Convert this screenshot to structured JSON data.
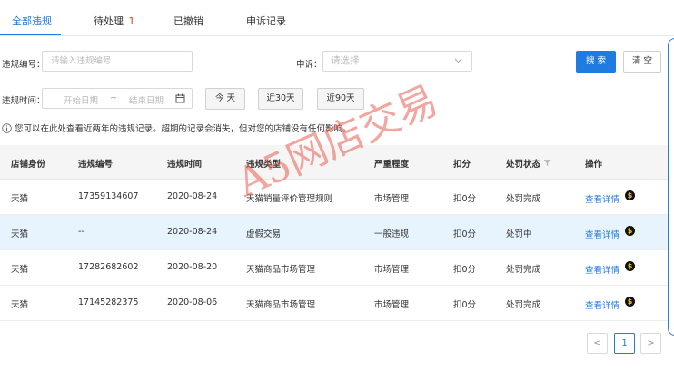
{
  "tabs": [
    {
      "label": "全部违规",
      "badge": ""
    },
    {
      "label": "待处理",
      "badge": "1"
    },
    {
      "label": "已撤销",
      "badge": ""
    },
    {
      "label": "申诉记录",
      "badge": ""
    }
  ],
  "filters": {
    "violation_id_label": "违规编号：",
    "violation_id_placeholder": "请输入违规编号",
    "appeal_label": "申诉：",
    "appeal_placeholder": "请选择",
    "time_label": "违规时间：",
    "start_date_placeholder": "开始日期",
    "date_separator": "~",
    "end_date_placeholder": "结束日期",
    "today_label": "今 天",
    "days30_label": "近30天",
    "days90_label": "近90天",
    "search_label": "搜 索",
    "clear_label": "清 空"
  },
  "notice": "您可以在此处查看近两年的违规记录。超期的记录会消失，但对您的店铺没有任何影响。",
  "table": {
    "columns": [
      "店铺身份",
      "违规编号",
      "违规时间",
      "违规类型",
      "严重程度",
      "扣分",
      "处罚状态",
      "操作"
    ],
    "rows": [
      {
        "identity": "天猫",
        "id": "17359134607",
        "time": "2020-08-24",
        "type": "天猫销量评价管理规则",
        "severity": "市场管理",
        "points": "扣0分",
        "status": "处罚完成",
        "action": "查看详情"
      },
      {
        "identity": "天猫",
        "id": "--",
        "time": "2020-08-24",
        "type": "虚假交易",
        "severity": "一般违规",
        "points": "扣0分",
        "status": "处罚中",
        "action": "查看详情"
      },
      {
        "identity": "天猫",
        "id": "17282682602",
        "time": "2020-08-20",
        "type": "天猫商品市场管理",
        "severity": "市场管理",
        "points": "扣0分",
        "status": "处罚完成",
        "action": "查看详情"
      },
      {
        "identity": "天猫",
        "id": "17145282375",
        "time": "2020-08-06",
        "type": "天猫商品市场管理",
        "severity": "市场管理",
        "points": "扣0分",
        "status": "处罚完成",
        "action": "查看详情"
      }
    ]
  },
  "pagination": {
    "prev": "<",
    "current": "1",
    "next": ">"
  },
  "watermark": "A5网店交易",
  "colors": {
    "accent": "#1f7be0",
    "badge": "#e8412f",
    "highlight_row": "#e8f4fd"
  }
}
